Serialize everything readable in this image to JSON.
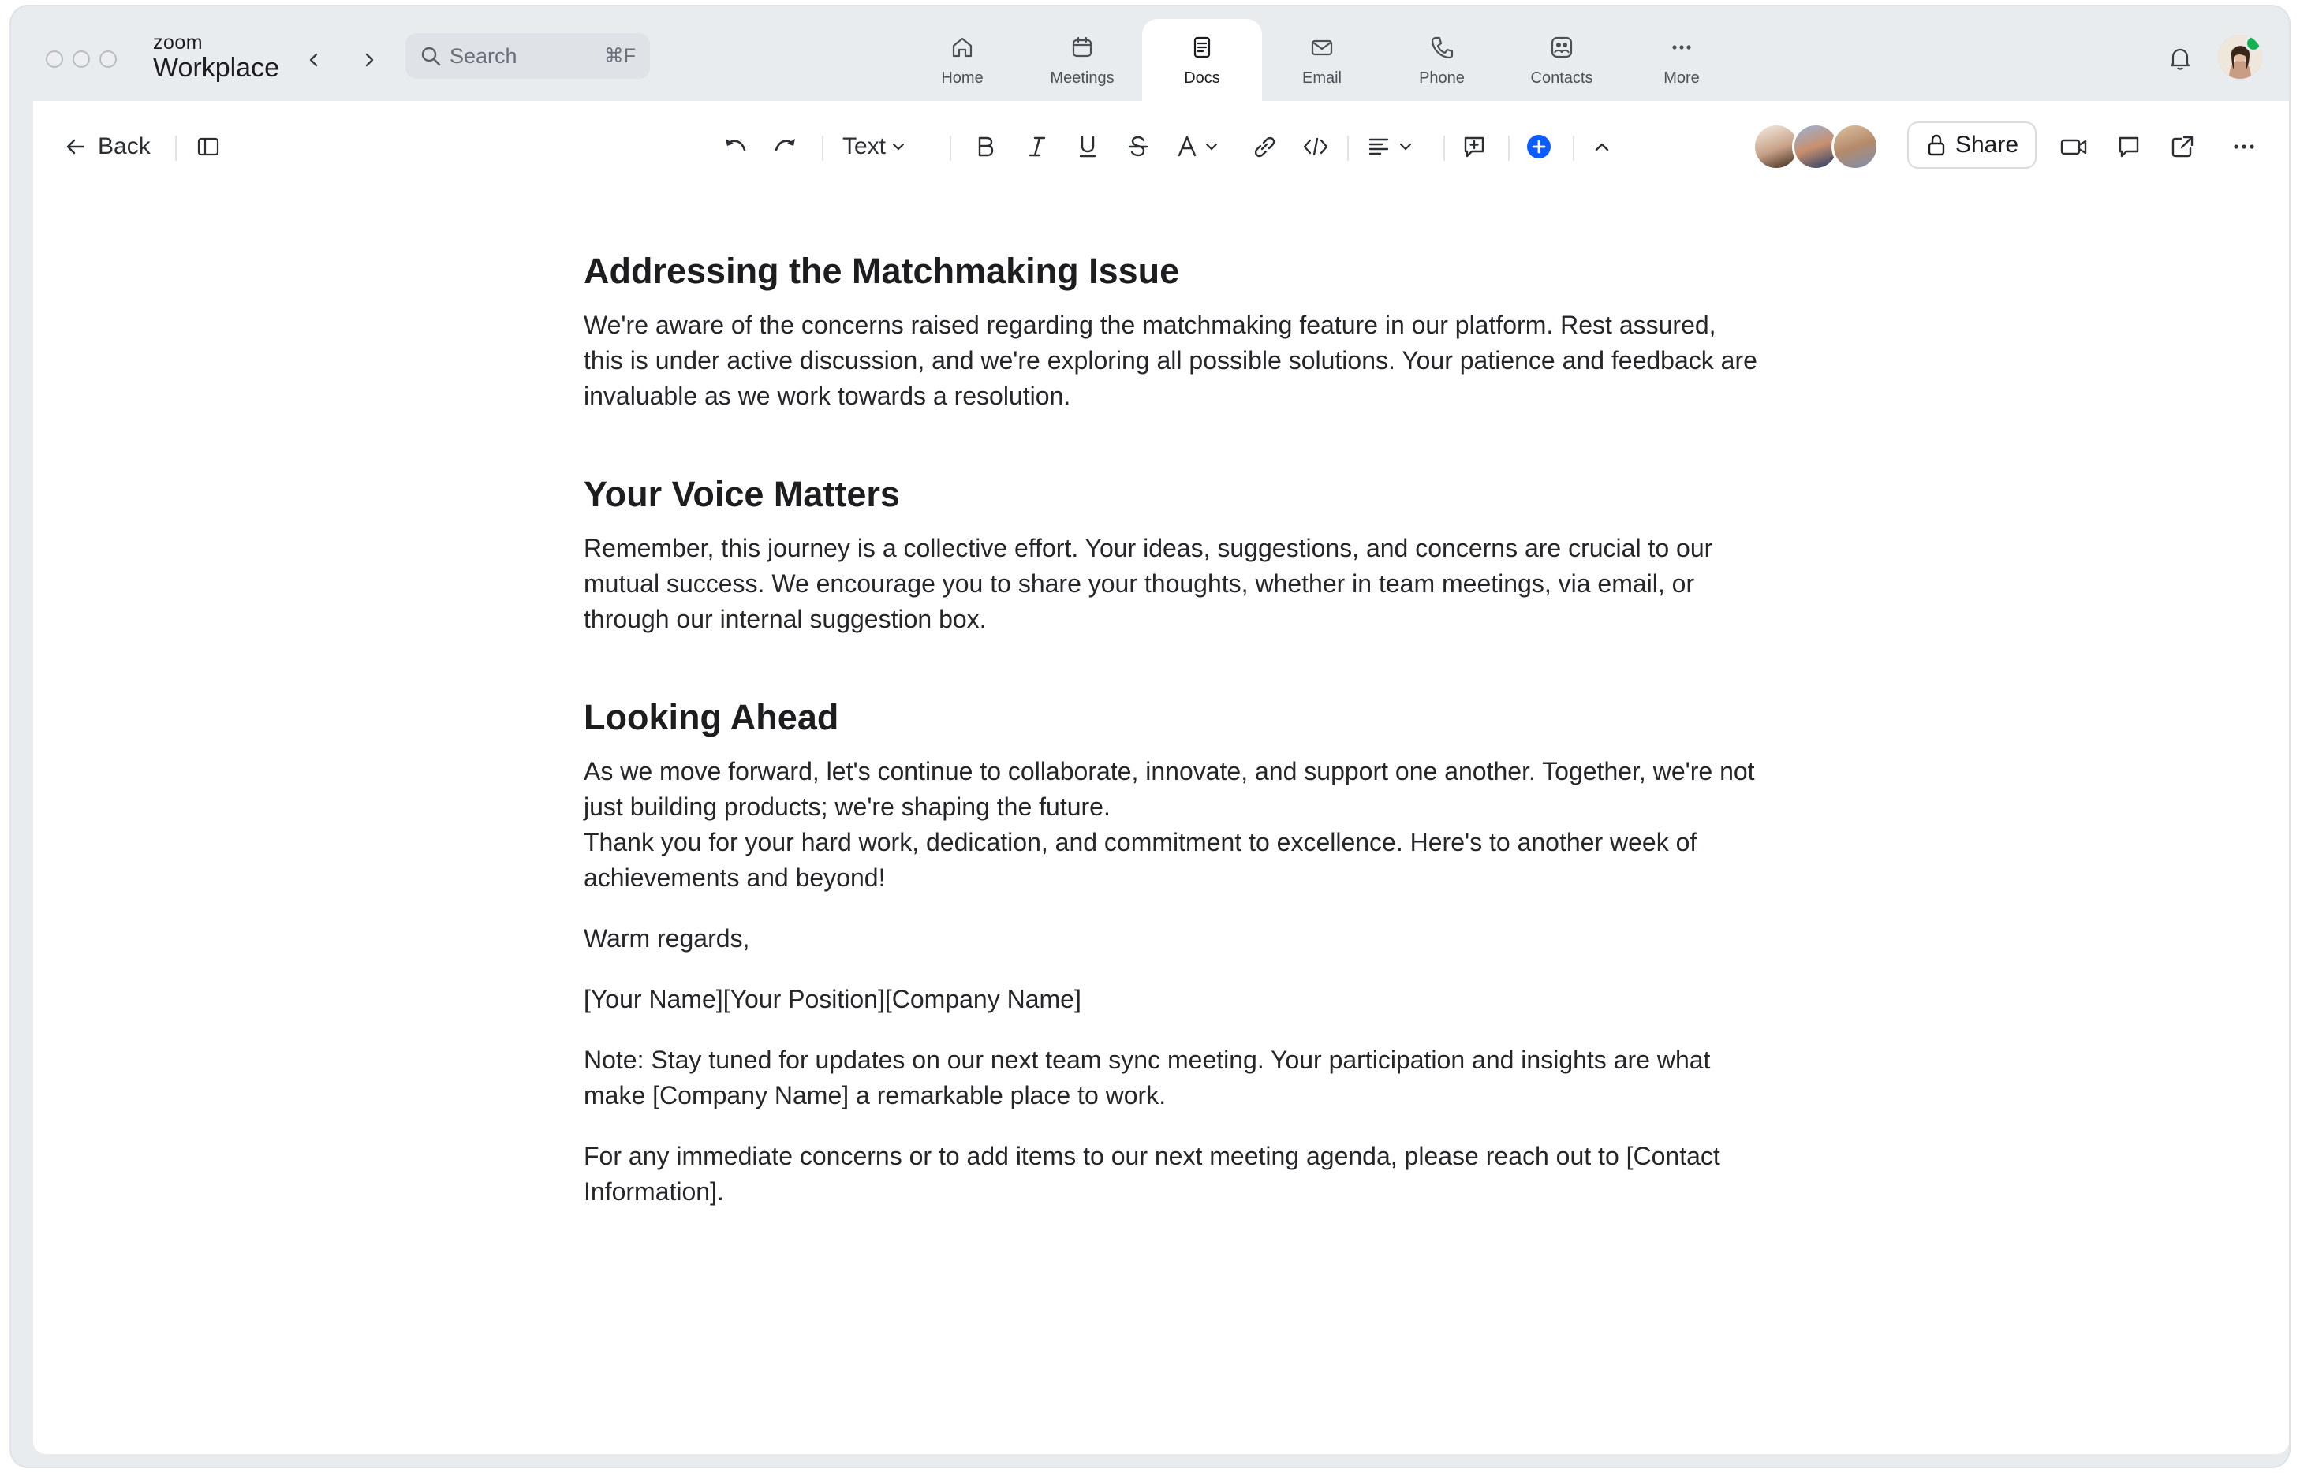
{
  "titlebar": {
    "brand_small": "zoom",
    "brand_big": "Workplace",
    "search_placeholder": "Search",
    "search_shortcut": "⌘F"
  },
  "tabs": [
    {
      "label": "Home",
      "icon": "home-icon"
    },
    {
      "label": "Meetings",
      "icon": "calendar-icon"
    },
    {
      "label": "Docs",
      "icon": "docs-icon",
      "active": true
    },
    {
      "label": "Email",
      "icon": "email-icon"
    },
    {
      "label": "Phone",
      "icon": "phone-icon"
    },
    {
      "label": "Contacts",
      "icon": "contacts-icon"
    },
    {
      "label": "More",
      "icon": "more-icon"
    }
  ],
  "toolbar": {
    "back_label": "Back",
    "text_style": "Text",
    "share_label": "Share"
  },
  "colors": {
    "accent": "#0b5cff",
    "online": "#16b153"
  },
  "doc": {
    "h1": "Addressing the Matchmaking Issue",
    "p1": "We're aware of the concerns raised regarding the matchmaking feature in our platform. Rest assured, this is under active discussion, and we're exploring all possible solutions. Your patience and feedback are invaluable as we work towards a resolution.",
    "h2": "Your Voice Matters",
    "p2": "Remember, this journey is a collective effort. Your ideas, suggestions, and concerns are crucial to our mutual success. We encourage you to share your thoughts, whether in team meetings, via email, or through our internal suggestion box.",
    "h3": "Looking Ahead",
    "p3a": "As we move forward, let's continue to collaborate, innovate, and support one another. Together, we're not just building products; we're shaping the future.",
    "p3b": "Thank you for your hard work, dedication, and commitment to excellence. Here's to another week of achievements and beyond!",
    "regards": "Warm regards,",
    "signature": "[Your Name][Your Position][Company Name]",
    "note": "Note: Stay tuned for updates on our next team sync meeting. Your participation and insights are what make [Company Name] a remarkable place to work.",
    "contact": "For any immediate concerns or to add items to our next meeting agenda, please reach out to [Contact Information]."
  }
}
